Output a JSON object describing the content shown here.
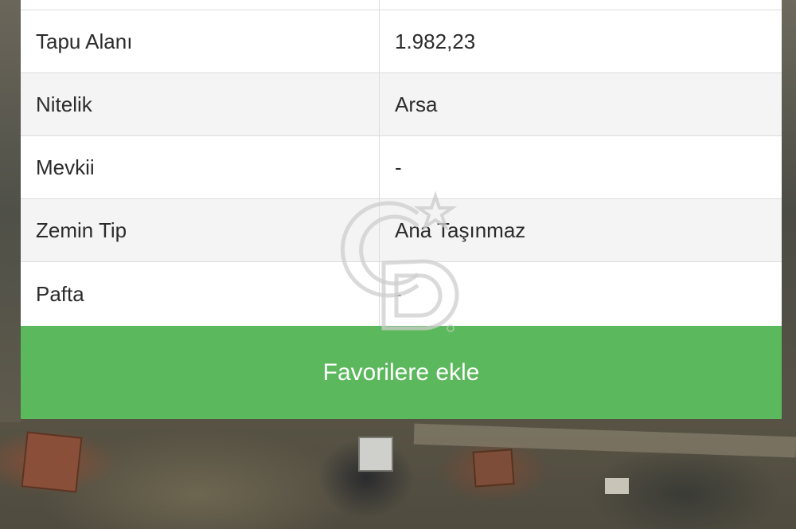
{
  "details": {
    "rows": [
      {
        "label": "",
        "value": ""
      },
      {
        "label": "Tapu Alanı",
        "value": "1.982,23"
      },
      {
        "label": "Nitelik",
        "value": "Arsa"
      },
      {
        "label": "Mevkii",
        "value": "-"
      },
      {
        "label": "Zemin Tip",
        "value": "Ana Taşınmaz"
      },
      {
        "label": "Pafta",
        "value": "-"
      }
    ]
  },
  "actions": {
    "favorite_label": "Favorilere ekle"
  },
  "colors": {
    "button_green": "#5cb85c",
    "row_alt": "#f4f4f4"
  },
  "watermark": {
    "icon": "coldwell-banker-cb-logo-icon"
  }
}
